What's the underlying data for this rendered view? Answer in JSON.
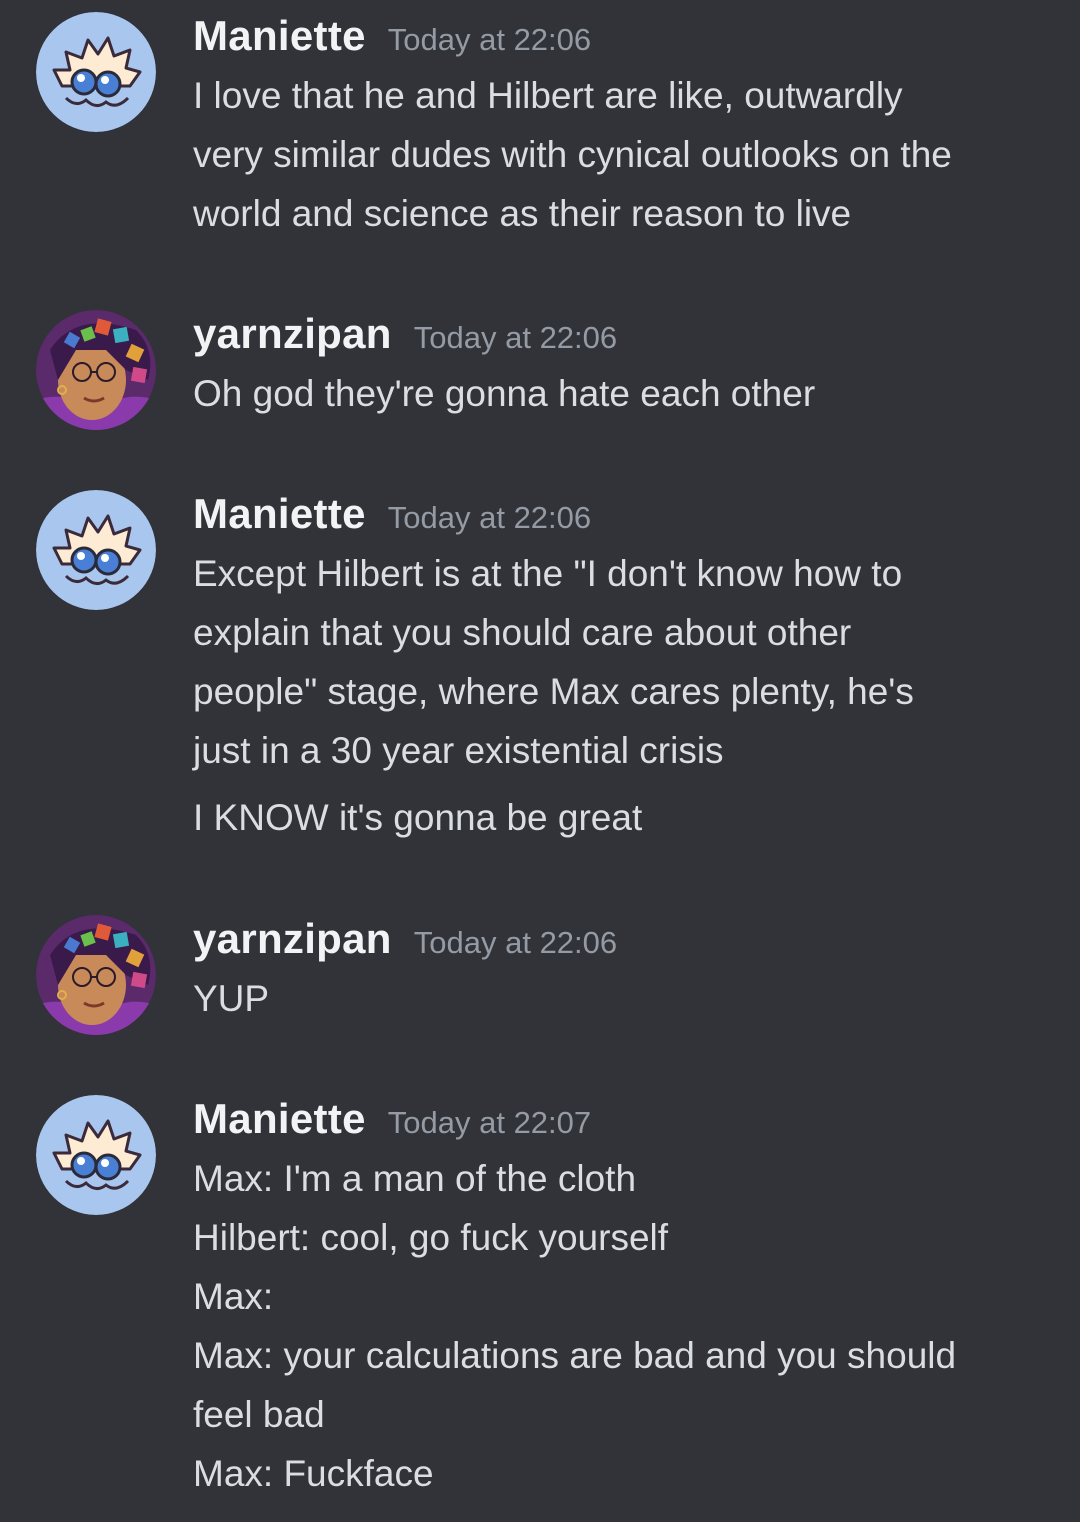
{
  "messages": [
    {
      "author": "Maniette",
      "avatar": "ghost-avatar-icon",
      "timestamp": "Today at 22:06",
      "lines": [
        "I love that he and Hilbert are like, outwardly",
        "very similar dudes with cynical outlooks on the",
        "world and science as their reason to live"
      ]
    },
    {
      "author": "yarnzipan",
      "avatar": "dice-portrait-avatar-icon",
      "timestamp": "Today at 22:06",
      "lines": [
        "Oh god they're gonna hate each other"
      ]
    },
    {
      "author": "Maniette",
      "avatar": "ghost-avatar-icon",
      "timestamp": "Today at 22:06",
      "lines": [
        "Except Hilbert is at the \"I don't know how to",
        "explain that you should care about other",
        "people\" stage, where Max cares plenty, he's",
        "just in a 30 year existential crisis"
      ],
      "followup": [
        "I KNOW it's gonna be great"
      ]
    },
    {
      "author": "yarnzipan",
      "avatar": "dice-portrait-avatar-icon",
      "timestamp": "Today at 22:06",
      "lines": [
        "YUP"
      ]
    },
    {
      "author": "Maniette",
      "avatar": "ghost-avatar-icon",
      "timestamp": "Today at 22:07",
      "lines": [
        "Max: I'm a man of the cloth",
        "Hilbert: cool, go fuck yourself",
        "Max:",
        "Max: your calculations are bad and you should",
        "feel bad",
        "Max: Fuckface"
      ]
    }
  ],
  "colors": {
    "background": "#313338",
    "username": "#f2f3f5",
    "timestamp": "#949ba4",
    "text": "#dbdee1"
  }
}
